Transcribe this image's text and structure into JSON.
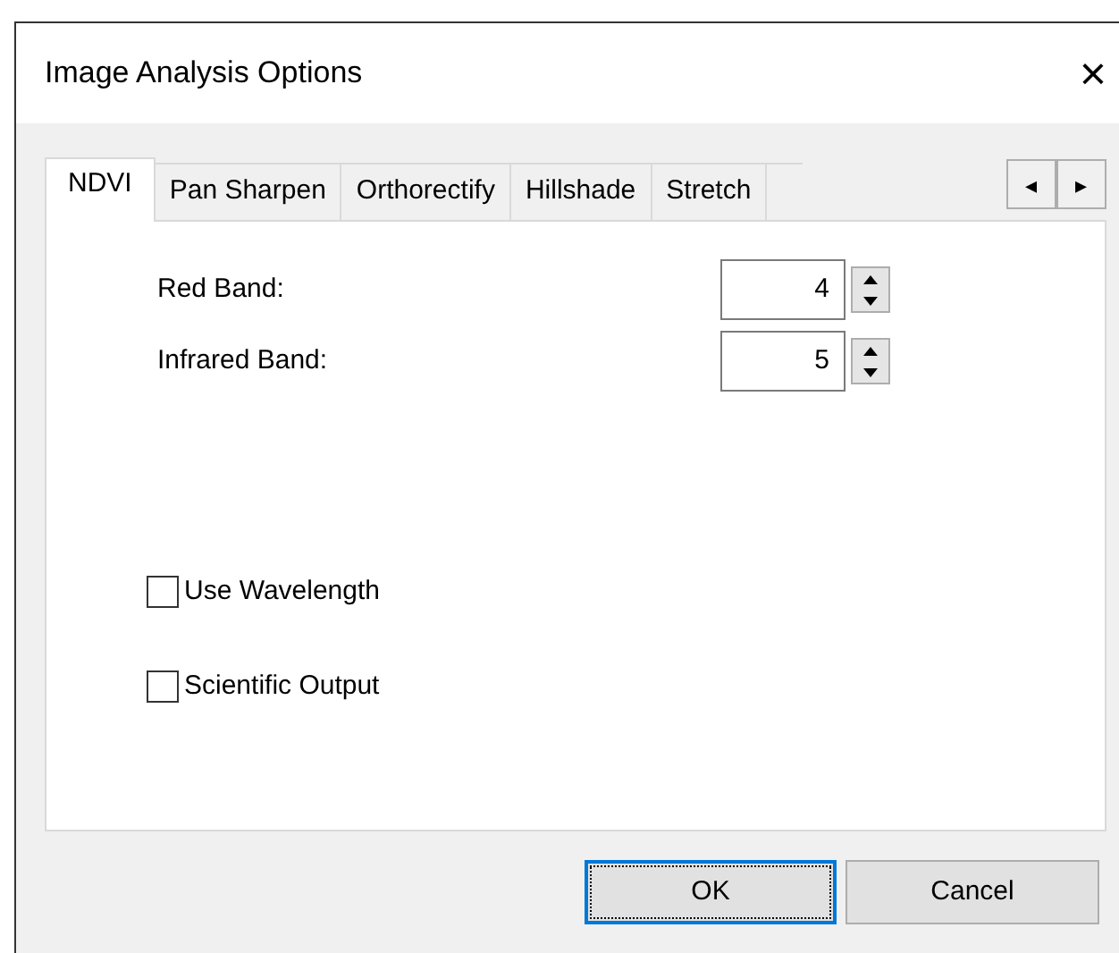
{
  "window": {
    "title": "Image Analysis Options",
    "close": "×"
  },
  "tabs": [
    {
      "label": "NDVI",
      "selected": true
    },
    {
      "label": "Pan Sharpen",
      "selected": false
    },
    {
      "label": "Orthorectify",
      "selected": false
    },
    {
      "label": "Hillshade",
      "selected": false
    },
    {
      "label": "Stretch",
      "selected": false
    }
  ],
  "tab_scroll": [
    "◂",
    "▸"
  ],
  "fields": [
    {
      "label": "Red Band:",
      "value": "4"
    },
    {
      "label": "Infrared Band:",
      "value": "5"
    }
  ],
  "checkboxes": [
    {
      "label": "Use Wavelength",
      "checked": false
    },
    {
      "label": "Scientific Output",
      "checked": false
    }
  ],
  "buttons": [
    {
      "label": "OK",
      "selected": true
    },
    {
      "label": "Cancel",
      "selected": false
    }
  ]
}
